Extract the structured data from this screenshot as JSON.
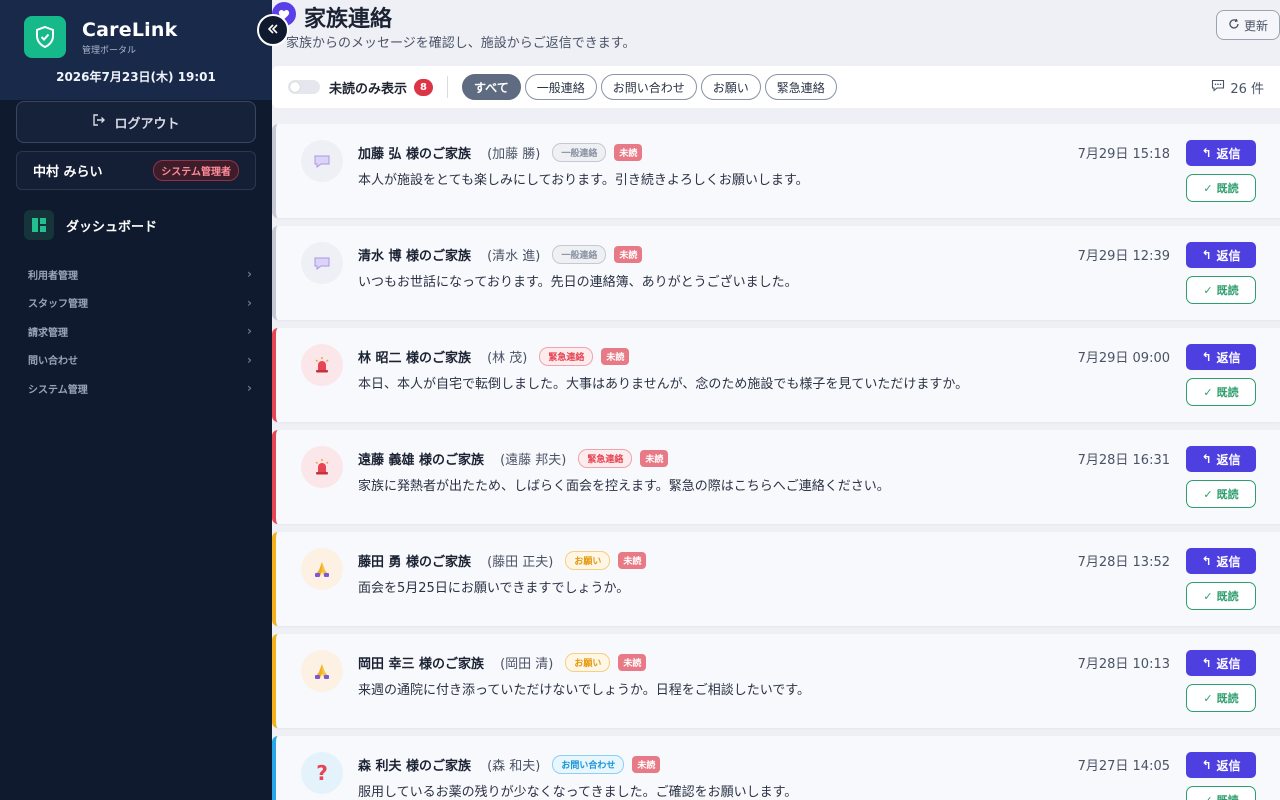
{
  "app": {
    "name": "CareLink",
    "subtitle": "管理ポータル",
    "datetime": "2026年7月23日(木) 19:01"
  },
  "sidebar": {
    "logout_label": "ログアウト",
    "user_name": "中村 みらい",
    "user_role": "システム管理者",
    "dashboard_label": "ダッシュボード",
    "items": [
      {
        "label": "利用者管理"
      },
      {
        "label": "スタッフ管理"
      },
      {
        "label": "請求管理"
      },
      {
        "label": "問い合わせ"
      },
      {
        "label": "システム管理"
      }
    ]
  },
  "header": {
    "title": "家族連絡",
    "subtitle": "家族からのメッセージを確認し、施設からご返信できます。",
    "refresh_label": "更新"
  },
  "filters": {
    "unread_only_label": "未読のみ表示",
    "unread_count": "8",
    "chips": [
      {
        "label": "すべて",
        "active": true
      },
      {
        "label": "一般連絡",
        "active": false
      },
      {
        "label": "お問い合わせ",
        "active": false
      },
      {
        "label": "お願い",
        "active": false
      },
      {
        "label": "緊急連絡",
        "active": false
      }
    ],
    "total_count": "26 件"
  },
  "messages": [
    {
      "sender": "加藤 弘 様のご家族",
      "real_name": "(加藤 勝)",
      "category": "一般連絡",
      "status": "未読",
      "time": "7月29日 15:18",
      "text": "本人が施設をとても楽しみにしております。引き続きよろしくお願いします。",
      "reply_label": "返信",
      "read_label": "既読"
    },
    {
      "sender": "清水 博 様のご家族",
      "real_name": "(清水 進)",
      "category": "一般連絡",
      "status": "未読",
      "time": "7月29日 12:39",
      "text": "いつもお世話になっております。先日の連絡簿、ありがとうございました。",
      "reply_label": "返信",
      "read_label": "既読"
    },
    {
      "sender": "林 昭二 様のご家族",
      "real_name": "(林 茂)",
      "category": "緊急連絡",
      "status": "未読",
      "time": "7月29日 09:00",
      "text": "本日、本人が自宅で転倒しました。大事はありませんが、念のため施設でも様子を見ていただけますか。",
      "reply_label": "返信",
      "read_label": "既読"
    },
    {
      "sender": "遠藤 義雄 様のご家族",
      "real_name": "(遠藤 邦夫)",
      "category": "緊急連絡",
      "status": "未読",
      "time": "7月28日 16:31",
      "text": "家族に発熱者が出たため、しばらく面会を控えます。緊急の際はこちらへご連絡ください。",
      "reply_label": "返信",
      "read_label": "既読"
    },
    {
      "sender": "藤田 勇 様のご家族",
      "real_name": "(藤田 正夫)",
      "category": "お願い",
      "status": "未読",
      "time": "7月28日 13:52",
      "text": "面会を5月25日にお願いできますでしょうか。",
      "reply_label": "返信",
      "read_label": "既読"
    },
    {
      "sender": "岡田 幸三 様のご家族",
      "real_name": "(岡田 清)",
      "category": "お願い",
      "status": "未読",
      "time": "7月28日 10:13",
      "text": "来週の通院に付き添っていただけないでしょうか。日程をご相談したいです。",
      "reply_label": "返信",
      "read_label": "既読"
    },
    {
      "sender": "森 利夫 様のご家族",
      "real_name": "(森 和夫)",
      "category": "お問い合わせ",
      "status": "未読",
      "time": "7月27日 14:05",
      "text": "服用しているお薬の残りが少なくなってきました。ご確認をお願いします。",
      "reply_label": "返信",
      "read_label": "既読"
    }
  ]
}
